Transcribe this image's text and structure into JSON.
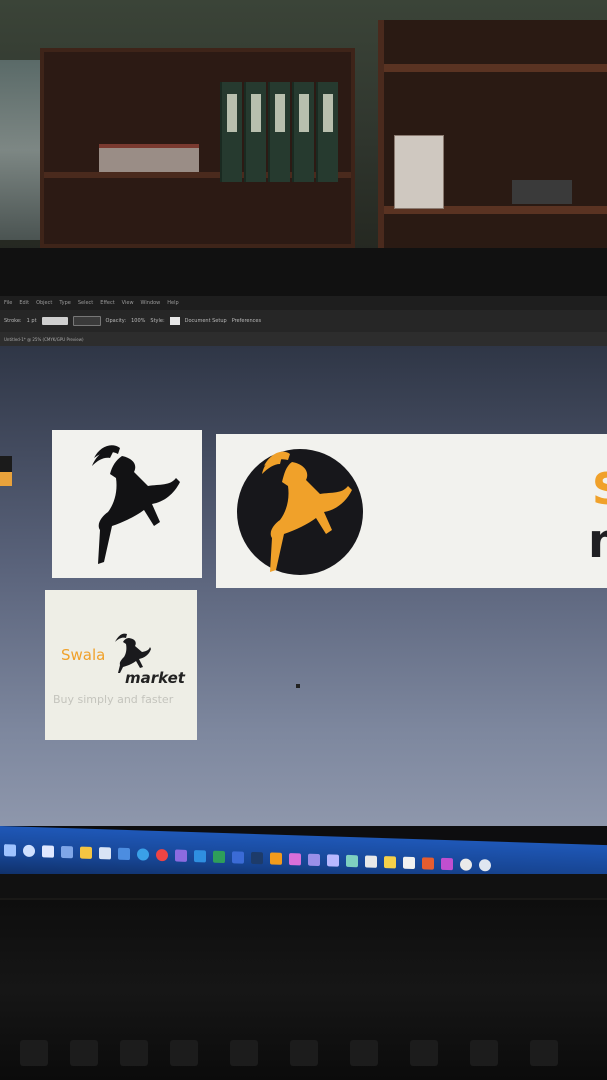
{
  "illustrator": {
    "menu": [
      "File",
      "Edit",
      "Object",
      "Type",
      "Select",
      "Effect",
      "View",
      "Window",
      "Help"
    ],
    "control_bar": {
      "stroke_label": "Stroke:",
      "stroke_value": "1 pt",
      "uniform_label": "Uniform",
      "basic_label": "5 pt. Round",
      "opacity_label": "Opacity:",
      "opacity_value": "100%",
      "style_label": "Style:",
      "doc_setup": "Document Setup",
      "preferences": "Preferences"
    },
    "doc_tab": "Untitled-1* @ 25% (CMYK/GPU Preview)"
  },
  "logo": {
    "brand_word_1": "Swala",
    "brand_word_2": "market",
    "small_brand_word_1": "Swala",
    "small_brand_word_2": "market",
    "tagline": "Buy simply and faster",
    "colors": {
      "orange": "#F0A12A",
      "dark": "#1F1F22",
      "circle": "#17171B"
    }
  },
  "taskbar": {
    "icons": [
      "start-icon",
      "search-icon",
      "cortana-icon",
      "task-view-icon",
      "file-explorer-icon",
      "store-icon",
      "mail-icon",
      "edge-icon",
      "chrome-icon",
      "visual-studio-icon",
      "vscode-icon",
      "excel-icon",
      "word-icon",
      "photoshop-icon",
      "illustrator-icon",
      "xd-icon",
      "premiere-icon",
      "aftereffects-icon",
      "audition-icon",
      "acrobat-icon",
      "media-player-icon",
      "notepad-icon",
      "onenote-icon",
      "powerpoint-icon",
      "settings-icon",
      "network-icon"
    ]
  }
}
